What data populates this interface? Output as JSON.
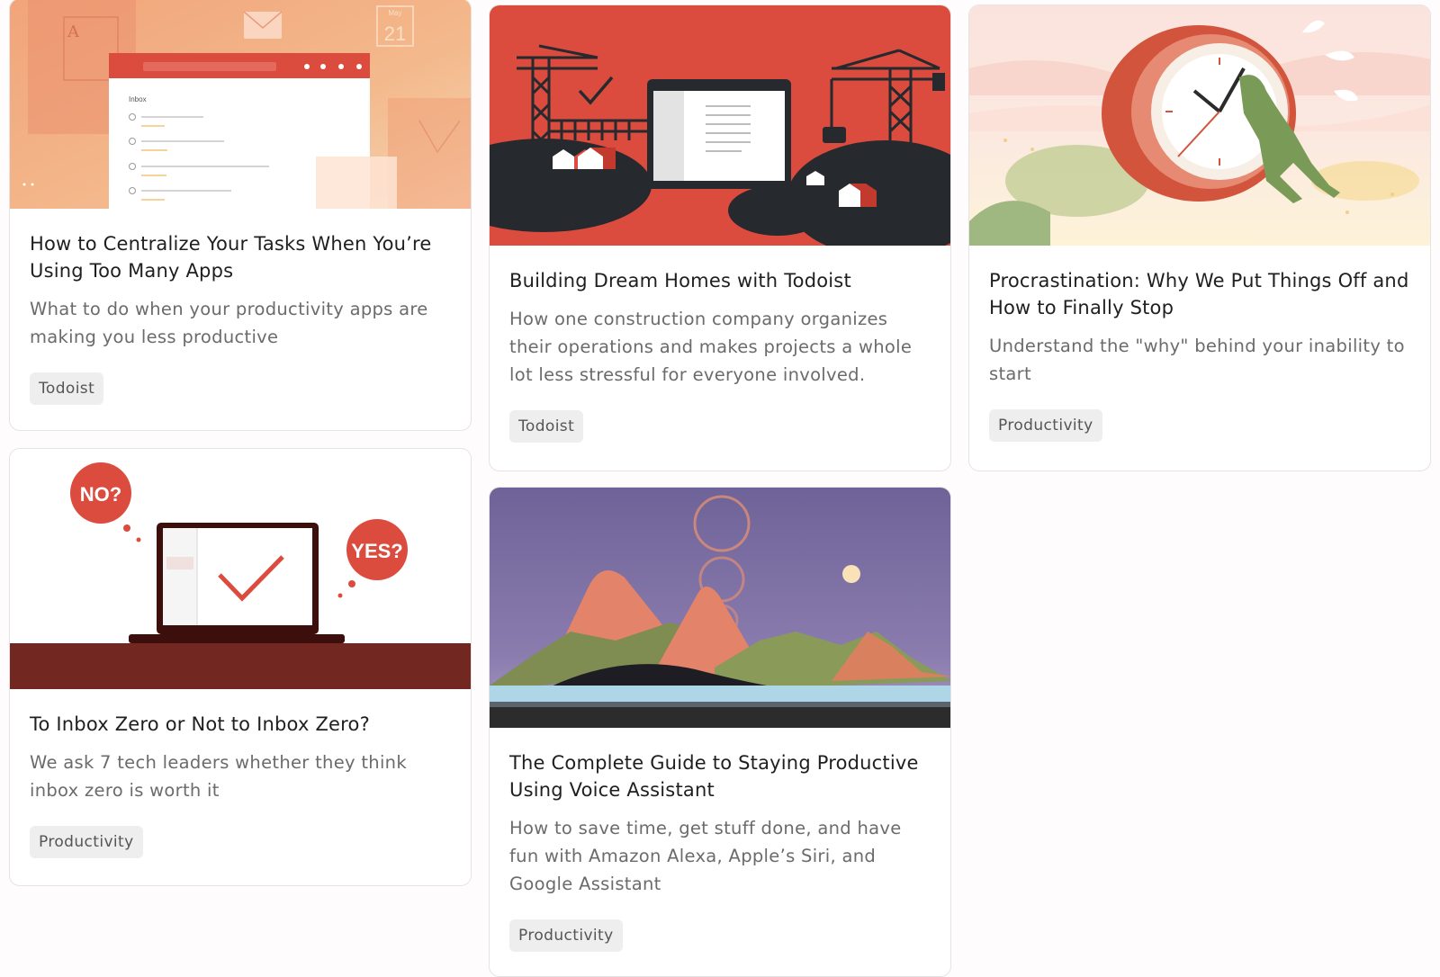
{
  "cards": [
    {
      "title": "How to Centralize Your Tasks When You’re Using Too Many Apps",
      "excerpt": "What to do when your productivity apps are making you less productive",
      "tag": "Todoist",
      "image": {
        "calendar_month": "May",
        "calendar_day": "21",
        "app_title": "Inbox",
        "icon": "todoist-app-illustration"
      }
    },
    {
      "title": "Building Dream Homes with Todoist",
      "excerpt": "How one construction company organizes their operations and makes projects a whole lot less stressful for everyone involved.",
      "tag": "Todoist",
      "image": {
        "icon": "construction-illustration"
      }
    },
    {
      "title": "Procrastination: Why We Put Things Off and How to Finally Stop",
      "excerpt": "Understand the \"why\" behind your inability to start",
      "tag": "Productivity",
      "image": {
        "icon": "clock-push-illustration"
      }
    },
    {
      "title": "To Inbox Zero or Not to Inbox Zero?",
      "excerpt": "We ask 7 tech leaders whether they think inbox zero is worth it",
      "tag": "Productivity",
      "image": {
        "no_label": "NO?",
        "yes_label": "YES?",
        "icon": "laptop-check-illustration"
      }
    },
    {
      "title": "The Complete Guide to Staying Productive Using Voice Assistant",
      "excerpt": "How to save time, get stuff done, and have fun with Amazon Alexa, Apple’s Siri, and Google Assistant",
      "tag": "Productivity",
      "image": {
        "icon": "mountain-landscape-illustration"
      }
    }
  ],
  "colors": {
    "brand_red": "#db4c3f",
    "dark_red": "#722821",
    "tag_bg": "#eeeeee"
  }
}
